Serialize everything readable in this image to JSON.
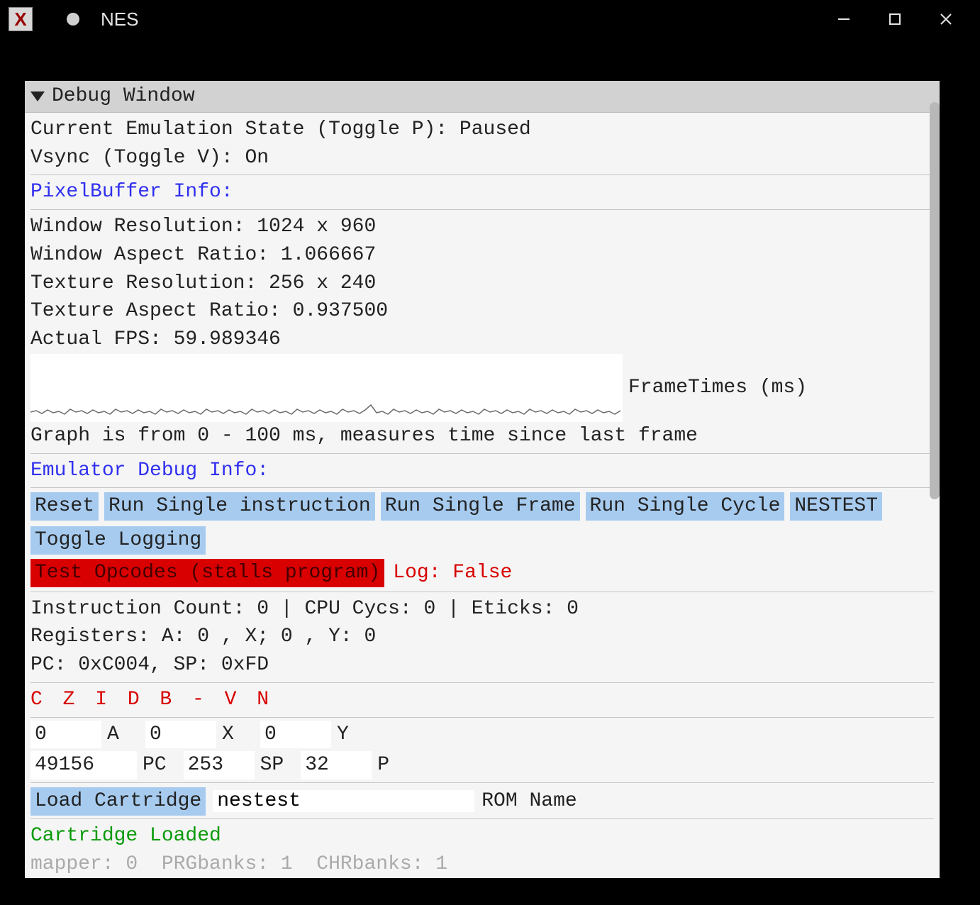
{
  "window": {
    "app_icon_glyph": "X",
    "title": "NES"
  },
  "panel": {
    "title": "Debug Window"
  },
  "state": {
    "emu_state_label": "Current Emulation State (Toggle P): ",
    "emu_state_value": "Paused",
    "vsync_label": "Vsync (Toggle V): ",
    "vsync_value": "On"
  },
  "pixelbuffer": {
    "header": "PixelBuffer Info:",
    "window_res": "Window Resolution: 1024 x 960",
    "window_aspect": "Window Aspect Ratio: 1.066667",
    "texture_res": "Texture Resolution: 256 x 240",
    "texture_aspect": "Texture Aspect Ratio: 0.937500",
    "fps": "Actual FPS: 59.989346",
    "frametimes_label": "FrameTimes (ms)",
    "graph_caption": "Graph is from 0 - 100 ms, measures time since last frame"
  },
  "emulator": {
    "header": "Emulator Debug Info:",
    "buttons": {
      "reset": "Reset",
      "run_single_instruction": "Run Single instruction",
      "run_single_frame": "Run Single Frame",
      "run_single_cycle": "Run Single Cycle",
      "nestest": "NESTEST",
      "toggle_logging": "Toggle Logging",
      "test_opcodes": "Test Opcodes (stalls program)"
    },
    "log_label": "Log: ",
    "log_value": "False",
    "counters": "Instruction Count: 0 | CPU Cycs: 0 | Eticks: 0",
    "registers_line": "Registers: A: 0 , X; 0 , Y: 0",
    "pc_sp_line": "PC: 0xC004, SP: 0xFD",
    "flags": "C Z I D B - V N",
    "reg_table": {
      "a_val": "0",
      "a_lbl": "A",
      "x_val": "0",
      "x_lbl": "X",
      "y_val": "0",
      "y_lbl": "Y",
      "pc_val": "49156",
      "pc_lbl": "PC",
      "sp_val": "253",
      "sp_lbl": "SP",
      "p_val": "32",
      "p_lbl": "P"
    },
    "load_cartridge": "Load Cartridge",
    "rom_name_value": "nestest",
    "rom_name_label": "ROM Name",
    "cartridge_status": "Cartridge Loaded",
    "mapper_line": "mapper: 0  PRGbanks: 1  CHRbanks: 1"
  }
}
